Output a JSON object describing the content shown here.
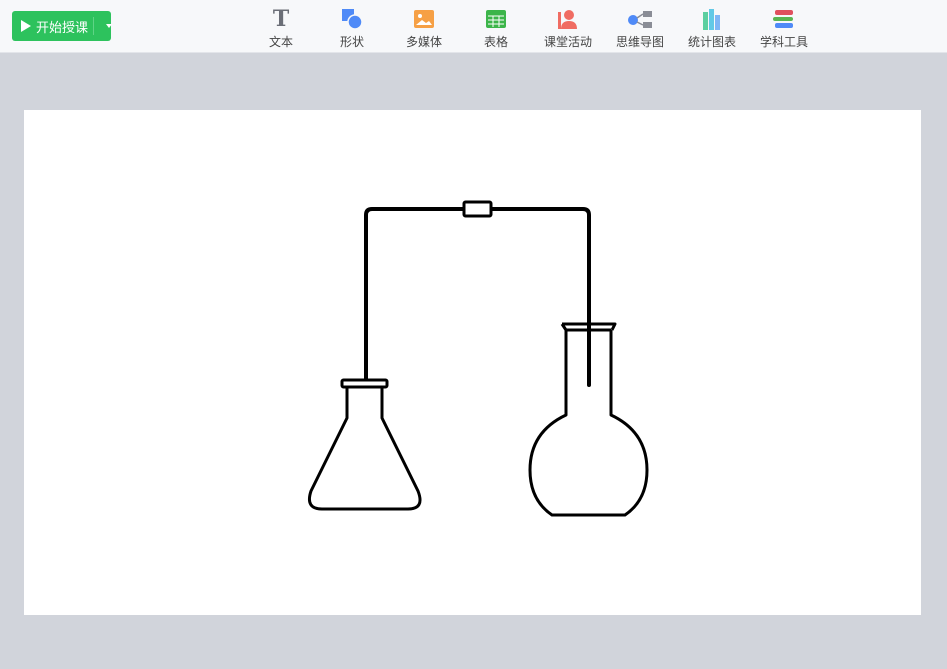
{
  "toolbar": {
    "start_button": "开始授课",
    "tools": [
      {
        "label": "文本",
        "icon": "text-icon",
        "color": "#6b6e77"
      },
      {
        "label": "形状",
        "icon": "shape-icon",
        "color": "#4f8af7"
      },
      {
        "label": "多媒体",
        "icon": "image-icon",
        "color": "#f6a045"
      },
      {
        "label": "表格",
        "icon": "table-icon",
        "color": "#3cb54a"
      },
      {
        "label": "课堂活动",
        "icon": "person-icon",
        "color": "#f06c62"
      },
      {
        "label": "思维导图",
        "icon": "mindmap-icon",
        "color": "#8a8d96"
      },
      {
        "label": "统计图表",
        "icon": "bar-chart-icon",
        "color": "#5ccfa0"
      },
      {
        "label": "学科工具",
        "icon": "books-icon",
        "color": "#e0505e"
      }
    ]
  },
  "colors": {
    "accent": "#2dc25d"
  }
}
